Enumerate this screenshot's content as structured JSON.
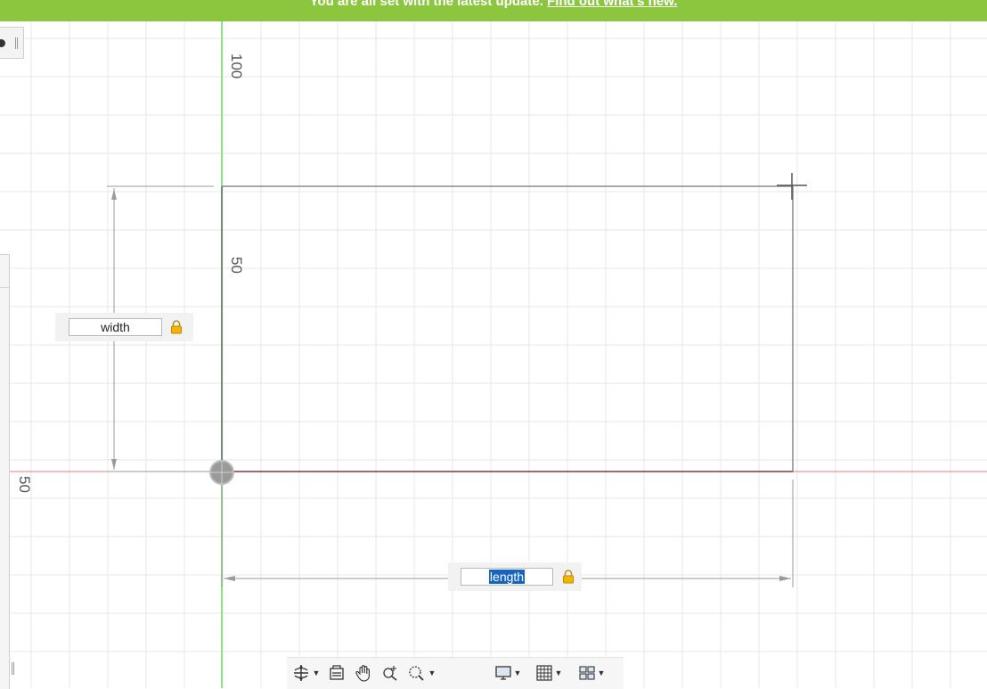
{
  "banner": {
    "message": "You are all set with the latest update. ",
    "link_text": "Find out what's new."
  },
  "rulers": {
    "vertical_top": "100",
    "vertical_mid": "50",
    "left_edge": "50"
  },
  "dimensions": {
    "width": {
      "value": "width",
      "locked": true
    },
    "length": {
      "value": "length",
      "locked": true,
      "selected": true
    }
  },
  "toolbar": {
    "items": [
      {
        "name": "orbit-icon",
        "has_menu": true
      },
      {
        "name": "look-at-icon",
        "has_menu": false
      },
      {
        "name": "pan-icon",
        "has_menu": false
      },
      {
        "name": "zoom-icon",
        "has_menu": false
      },
      {
        "name": "fit-icon",
        "has_menu": true
      },
      {
        "name": "display-settings-icon",
        "has_menu": true
      },
      {
        "name": "grid-settings-icon",
        "has_menu": true
      },
      {
        "name": "viewports-icon",
        "has_menu": true
      }
    ]
  },
  "colors": {
    "banner": "#8cc63f",
    "x_axis": "#d9534f",
    "y_axis": "#7fe07f",
    "selection": "#1565c0",
    "lock": "#f2b600"
  }
}
